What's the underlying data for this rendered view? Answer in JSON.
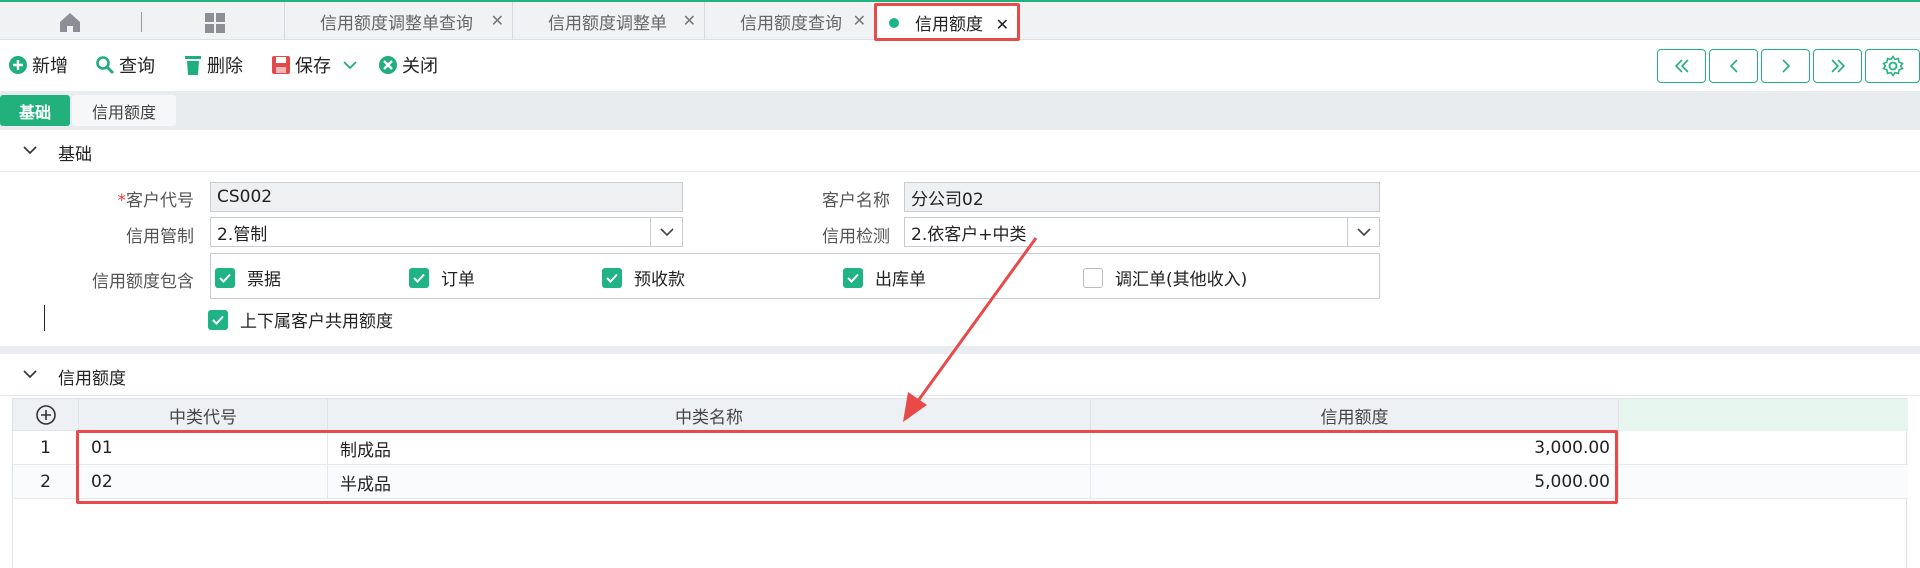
{
  "tabs": [
    {
      "label": "信用额度调整单查询",
      "close": "✕"
    },
    {
      "label": "信用额度调整单",
      "close": "✕"
    },
    {
      "label": "信用额度查询",
      "close": "✕"
    },
    {
      "label": "信用额度",
      "close": "✕"
    }
  ],
  "toolbar": {
    "new_label": "新增",
    "query_label": "查询",
    "delete_label": "删除",
    "save_label": "保存",
    "close_label": "关闭"
  },
  "page_tabs": [
    "基础",
    "信用额度"
  ],
  "section_basic": {
    "title": "基础"
  },
  "form": {
    "customer_code_label": "客户代号",
    "customer_code_required": "*",
    "customer_code_value": "CS002",
    "customer_name_label": "客户名称",
    "customer_name_value": "分公司02",
    "credit_control_label": "信用管制",
    "credit_control_value": "2.管制",
    "credit_check_label": "信用检测",
    "credit_check_value": "2.依客户+中类",
    "credit_include_label": "信用额度包含",
    "include_options": [
      {
        "label": "票据",
        "checked": true
      },
      {
        "label": "订单",
        "checked": true
      },
      {
        "label": "预收款",
        "checked": true
      },
      {
        "label": "出库单",
        "checked": true
      },
      {
        "label": "调汇单(其他收入)",
        "checked": false
      }
    ],
    "share_label": "上下属客户共用额度",
    "share_checked": true
  },
  "section_credit": {
    "title": "信用额度"
  },
  "grid": {
    "columns": [
      "中类代号",
      "中类名称",
      "信用额度"
    ],
    "rows": [
      {
        "index": "1",
        "code": "01",
        "name": "制成品",
        "amount": "3,000.00"
      },
      {
        "index": "2",
        "code": "02",
        "name": "半成品",
        "amount": "5,000.00"
      }
    ]
  },
  "colors": {
    "accent": "#23b27e",
    "highlight": "#e84a4a"
  }
}
